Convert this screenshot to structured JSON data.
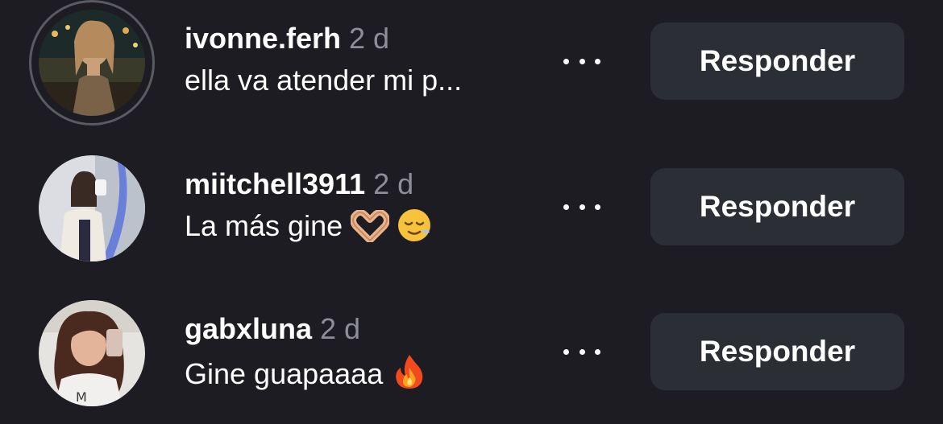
{
  "comments": [
    {
      "username": "ivonne.ferh",
      "time": "2 d",
      "text": "ella va atender mi p...",
      "has_story_ring": true,
      "emojis": [],
      "more_icon": "more-horizontal-icon",
      "reply_label": "Responder"
    },
    {
      "username": "miitchell3911",
      "time": "2 d",
      "text": "La más gine",
      "has_story_ring": false,
      "emojis": [
        "🫶",
        "😌"
      ],
      "more_icon": "more-horizontal-icon",
      "reply_label": "Responder"
    },
    {
      "username": "gabxluna",
      "time": "2 d",
      "text": "Gine guapaaaa",
      "has_story_ring": false,
      "emojis": [
        "🔥"
      ],
      "more_icon": "more-horizontal-icon",
      "reply_label": "Responder"
    }
  ],
  "colors": {
    "background": "#1c1c22",
    "button": "#2c2e36",
    "muted_text": "#8e8e96",
    "story_ring": "#5a5a62"
  }
}
